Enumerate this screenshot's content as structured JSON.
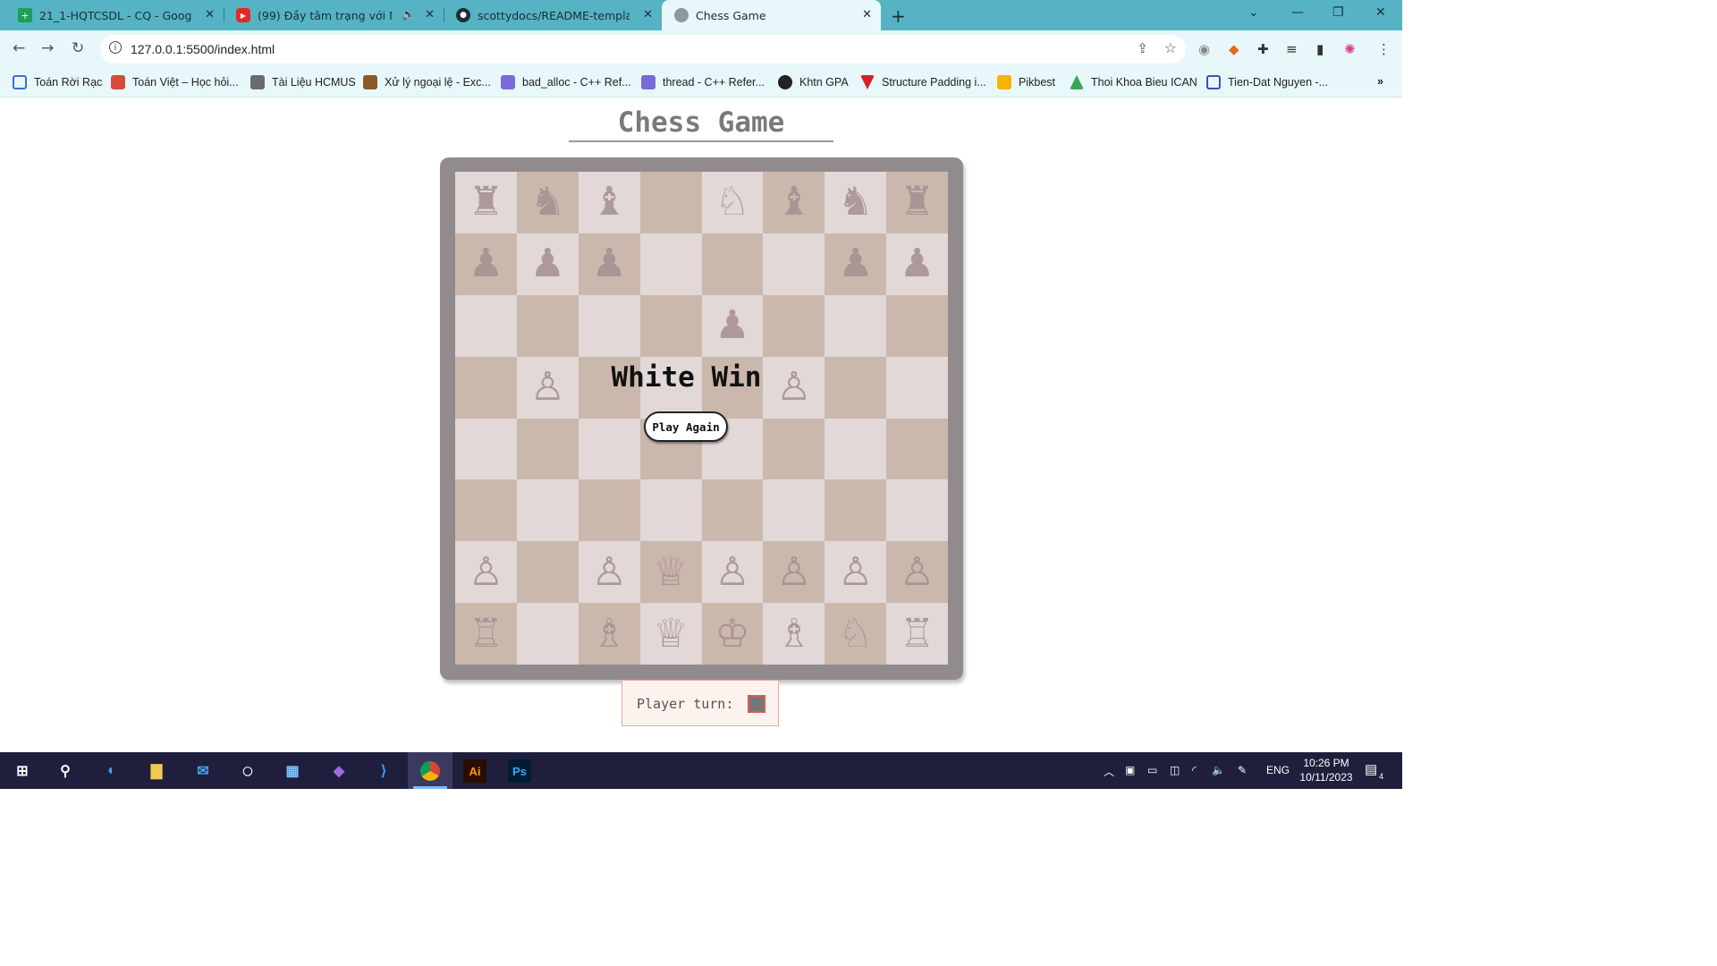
{
  "browser": {
    "tabs": [
      {
        "label": "21_1-HQTCSDL - CQ - Google Tr",
        "icon": "sheets-icon"
      },
      {
        "label": "(99) Đầy tâm trạng với NGH",
        "icon": "youtube-icon"
      },
      {
        "label": "scottydocs/README-template.m",
        "icon": "github-icon"
      },
      {
        "label": "Chess Game",
        "icon": "globe-icon"
      }
    ],
    "new_tab": "+",
    "url": "127.0.0.1:5500/index.html",
    "bookmarks": [
      {
        "label": "Toán Rời Rạc",
        "color": "#3b6fd6"
      },
      {
        "label": "Toán Việt – Học hỏi...",
        "color": "#d64b3b"
      },
      {
        "label": "Tài Liệu HCMUS",
        "color": "#6b6b6b"
      },
      {
        "label": "Xử lý ngoại lệ - Exc...",
        "color": "#8a5a2b"
      },
      {
        "label": "bad_alloc - C++ Ref...",
        "color": "#7a6ad8"
      },
      {
        "label": "thread - C++ Refer...",
        "color": "#7a6ad8"
      },
      {
        "label": "Khtn GPA",
        "color": "#222222"
      },
      {
        "label": "Structure Padding i...",
        "color": "#d81f2a"
      },
      {
        "label": "Pikbest",
        "color": "#f4b400"
      },
      {
        "label": "Thoi Khoa Bieu ICAN",
        "color": "#34a853"
      },
      {
        "label": "Tien-Dat Nguyen -...",
        "color": "#3b4fc0"
      }
    ],
    "more": "»"
  },
  "page": {
    "title": "Chess Game",
    "result": "White Win",
    "play_again": "Play Again",
    "turn_label": "Player turn:"
  },
  "board": [
    [
      "♜",
      "♞",
      "♝",
      "",
      "♘",
      "♝",
      "♞",
      "♜"
    ],
    [
      "♟",
      "♟",
      "♟",
      "",
      "",
      "",
      "♟",
      "♟"
    ],
    [
      "",
      "",
      "",
      "",
      "♟",
      "",
      "",
      ""
    ],
    [
      "",
      "♙",
      "",
      "",
      "",
      "♙",
      "",
      ""
    ],
    [
      "",
      "",
      "",
      "",
      "",
      "",
      "",
      ""
    ],
    [
      "",
      "",
      "",
      "",
      "",
      "",
      "",
      ""
    ],
    [
      "♙",
      "",
      "♙",
      "♕",
      "♙",
      "♙",
      "♙",
      "♙"
    ],
    [
      "♖",
      "",
      "♗",
      "♕",
      "♔",
      "♗",
      "♘",
      "♖"
    ]
  ],
  "taskbar": {
    "language": "ENG",
    "time": "10:26 PM",
    "date": "10/11/2023",
    "notifications": "4"
  }
}
